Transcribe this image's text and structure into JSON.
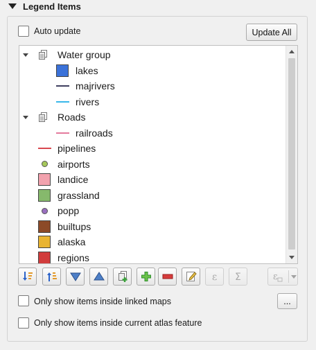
{
  "section": {
    "title": "Legend Items",
    "icon": "collapse-triangle-icon"
  },
  "auto_update": {
    "label": "Auto update",
    "checked": false
  },
  "update_all": {
    "label": "Update All"
  },
  "tree": {
    "items": [
      {
        "type": "group",
        "label": "Water group",
        "icon": "group-layers-icon"
      },
      {
        "type": "child",
        "label": "lakes",
        "symbol": "fill",
        "color": "#3b72d9"
      },
      {
        "type": "child",
        "label": "majrivers",
        "symbol": "line",
        "color": "#3f3f5f"
      },
      {
        "type": "child",
        "label": "rivers",
        "symbol": "line",
        "color": "#37b7ea"
      },
      {
        "type": "group",
        "label": "Roads",
        "icon": "group-layers-icon"
      },
      {
        "type": "child",
        "label": "railroads",
        "symbol": "line",
        "color": "#e47a9c"
      },
      {
        "type": "layer",
        "label": "pipelines",
        "symbol": "line",
        "color": "#d8474f"
      },
      {
        "type": "layer",
        "label": "airports",
        "symbol": "point",
        "color": "#a6c85a"
      },
      {
        "type": "layer",
        "label": "landice",
        "symbol": "fill",
        "color": "#f2a2ae"
      },
      {
        "type": "layer",
        "label": "grassland",
        "symbol": "fill",
        "color": "#86b96c"
      },
      {
        "type": "layer",
        "label": "popp",
        "symbol": "point",
        "color": "#9a6fc0"
      },
      {
        "type": "layer",
        "label": "builtups",
        "symbol": "fill",
        "color": "#8c4a28"
      },
      {
        "type": "layer",
        "label": "alaska",
        "symbol": "fill",
        "color": "#e9b431"
      },
      {
        "type": "layer",
        "label": "regions",
        "symbol": "fill",
        "color": "#d13c3c"
      }
    ]
  },
  "toolbar": {
    "buttons": [
      {
        "name": "sort-descending-icon",
        "enabled": true
      },
      {
        "name": "sort-ascending-icon",
        "enabled": true
      },
      {
        "name": "move-down-icon",
        "enabled": true
      },
      {
        "name": "move-up-icon",
        "enabled": true
      },
      {
        "name": "add-group-icon",
        "enabled": true
      },
      {
        "name": "add-item-icon",
        "enabled": true
      },
      {
        "name": "remove-item-icon",
        "enabled": true
      },
      {
        "name": "edit-item-icon",
        "enabled": true
      },
      {
        "name": "expression-icon",
        "enabled": false
      },
      {
        "name": "sum-icon",
        "enabled": false
      },
      {
        "name": "expression-filter-icon",
        "enabled": false
      }
    ]
  },
  "linked_maps": {
    "label": "Only show items inside linked maps",
    "checked": false,
    "button_label": "..."
  },
  "atlas_feature": {
    "label": "Only show items inside current atlas feature",
    "checked": false
  }
}
